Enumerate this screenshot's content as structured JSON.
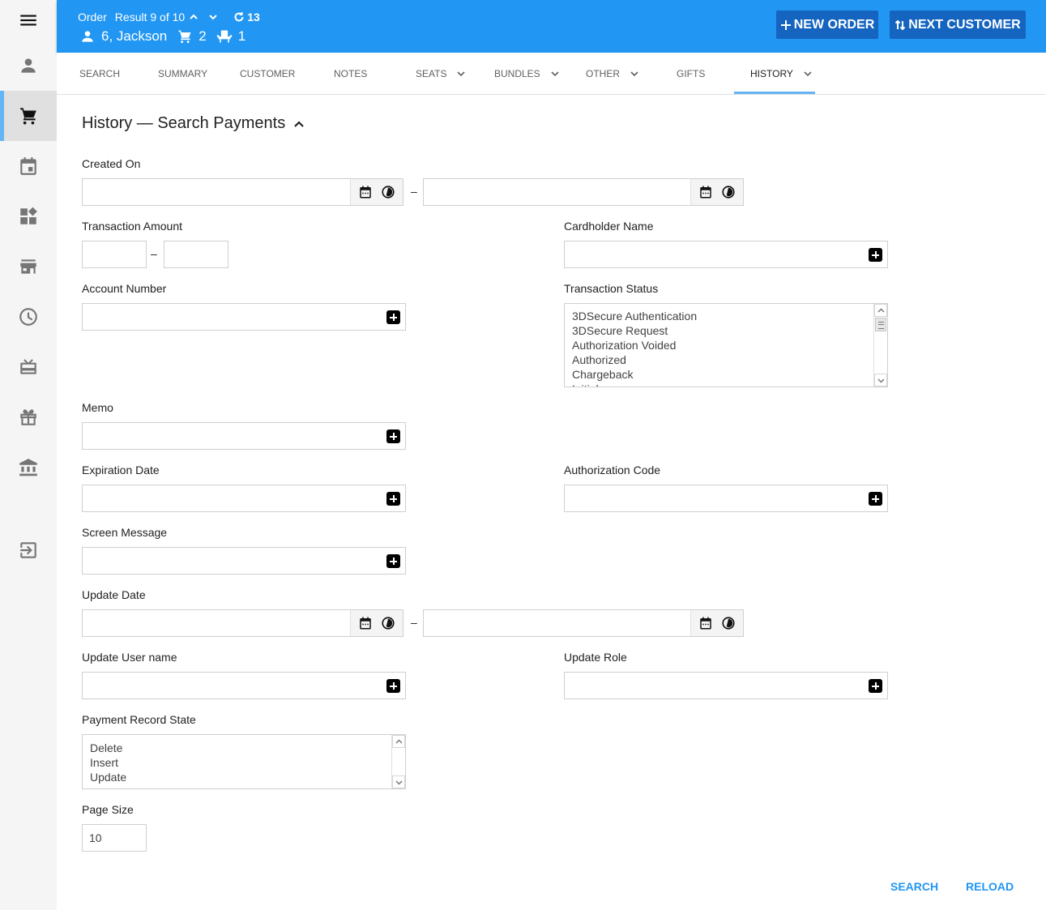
{
  "header": {
    "order_label": "Order",
    "result_text": "Result 9 of 10",
    "history_count": "13",
    "customer": "6, Jackson",
    "cart_count": "2",
    "seat_count": "1",
    "new_order_label": "NEW ORDER",
    "next_customer_label": "NEXT CUSTOMER",
    "header_color": "#2196f3",
    "button_color": "#1565c0"
  },
  "sidebar": {
    "items": [
      {
        "icon": "menu-icon"
      },
      {
        "icon": "person-icon"
      },
      {
        "icon": "cart-icon",
        "active": true
      },
      {
        "icon": "calendar-icon"
      },
      {
        "icon": "widgets-icon"
      },
      {
        "icon": "store-icon"
      },
      {
        "icon": "clock-icon"
      },
      {
        "icon": "card-giftcard-icon"
      },
      {
        "icon": "gift-icon"
      },
      {
        "icon": "bank-icon"
      },
      {
        "icon": "logout-icon"
      }
    ]
  },
  "tabs": [
    {
      "label": "SEARCH"
    },
    {
      "label": "SUMMARY"
    },
    {
      "label": "CUSTOMER"
    },
    {
      "label": "NOTES"
    },
    {
      "label": "SEATS",
      "dropdown": true
    },
    {
      "label": "BUNDLES",
      "dropdown": true
    },
    {
      "label": "OTHER",
      "dropdown": true
    },
    {
      "label": "GIFTS"
    },
    {
      "label": "HISTORY",
      "dropdown": true,
      "active": true
    }
  ],
  "form": {
    "title": "History — Search Payments",
    "created_on": {
      "label": "Created On",
      "from": "",
      "to": ""
    },
    "transaction_amount": {
      "label": "Transaction Amount",
      "min": "",
      "max": ""
    },
    "cardholder_name": {
      "label": "Cardholder Name",
      "value": ""
    },
    "account_number": {
      "label": "Account Number",
      "value": ""
    },
    "transaction_status": {
      "label": "Transaction Status",
      "options": [
        "3DSecure Authentication",
        "3DSecure Request",
        "Authorization Voided",
        "Authorized",
        "Chargeback",
        "Initial"
      ]
    },
    "memo": {
      "label": "Memo",
      "value": ""
    },
    "expiration_date": {
      "label": "Expiration Date",
      "value": ""
    },
    "authorization_code": {
      "label": "Authorization Code",
      "value": ""
    },
    "screen_message": {
      "label": "Screen Message",
      "value": ""
    },
    "update_date": {
      "label": "Update Date",
      "from": "",
      "to": ""
    },
    "update_user_name": {
      "label": "Update User name",
      "value": ""
    },
    "update_role": {
      "label": "Update Role",
      "value": ""
    },
    "payment_record_state": {
      "label": "Payment Record State",
      "options": [
        "Delete",
        "Insert",
        "Update"
      ]
    },
    "page_size": {
      "label": "Page Size",
      "value": "10"
    },
    "range_separator": "–"
  },
  "actions": {
    "search_label": "SEARCH",
    "reload_label": "RELOAD",
    "accent_color": "#2196f3"
  }
}
